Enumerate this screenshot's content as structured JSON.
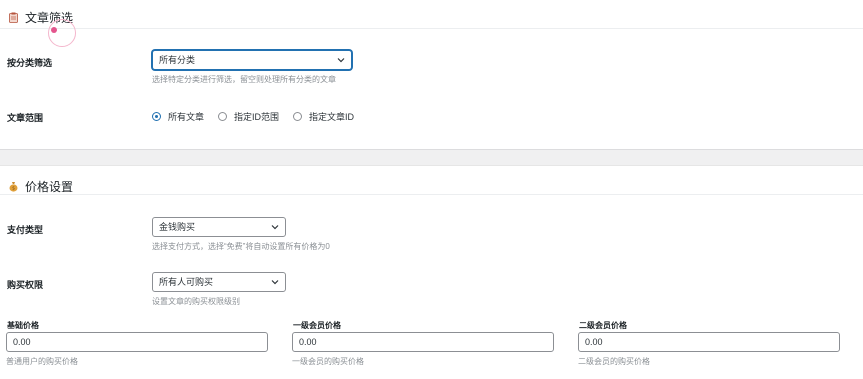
{
  "filter_section": {
    "title": "文章筛选",
    "category_label": "按分类筛选",
    "category_select": "所有分类",
    "category_help": "选择特定分类进行筛选，留空则处理所有分类的文章",
    "range_label": "文章范围",
    "range_options": [
      "所有文章",
      "指定ID范围",
      "指定文章ID"
    ],
    "range_selected_index": 0
  },
  "price_section": {
    "title": "价格设置",
    "pay_type_label": "支付类型",
    "pay_type_select": "金钱购买",
    "pay_type_help": "选择支付方式，选择“免费”将自动设置所有价格为0",
    "permission_label": "购买权限",
    "permission_select": "所有人可购买",
    "permission_help": "设置文章的购买权限级别",
    "prices": [
      {
        "label": "基础价格",
        "value": "0.00",
        "help": "普通用户的购买价格"
      },
      {
        "label": "一级会员价格",
        "value": "0.00",
        "help": "一级会员的购买价格"
      },
      {
        "label": "二级会员价格",
        "value": "0.00",
        "help": "二级会员的购买价格"
      }
    ]
  },
  "icons": {
    "filter": "clipboard-icon",
    "price": "money-bag-icon"
  },
  "colors": {
    "accent": "#2271b1",
    "cursor": "#e4558d"
  }
}
